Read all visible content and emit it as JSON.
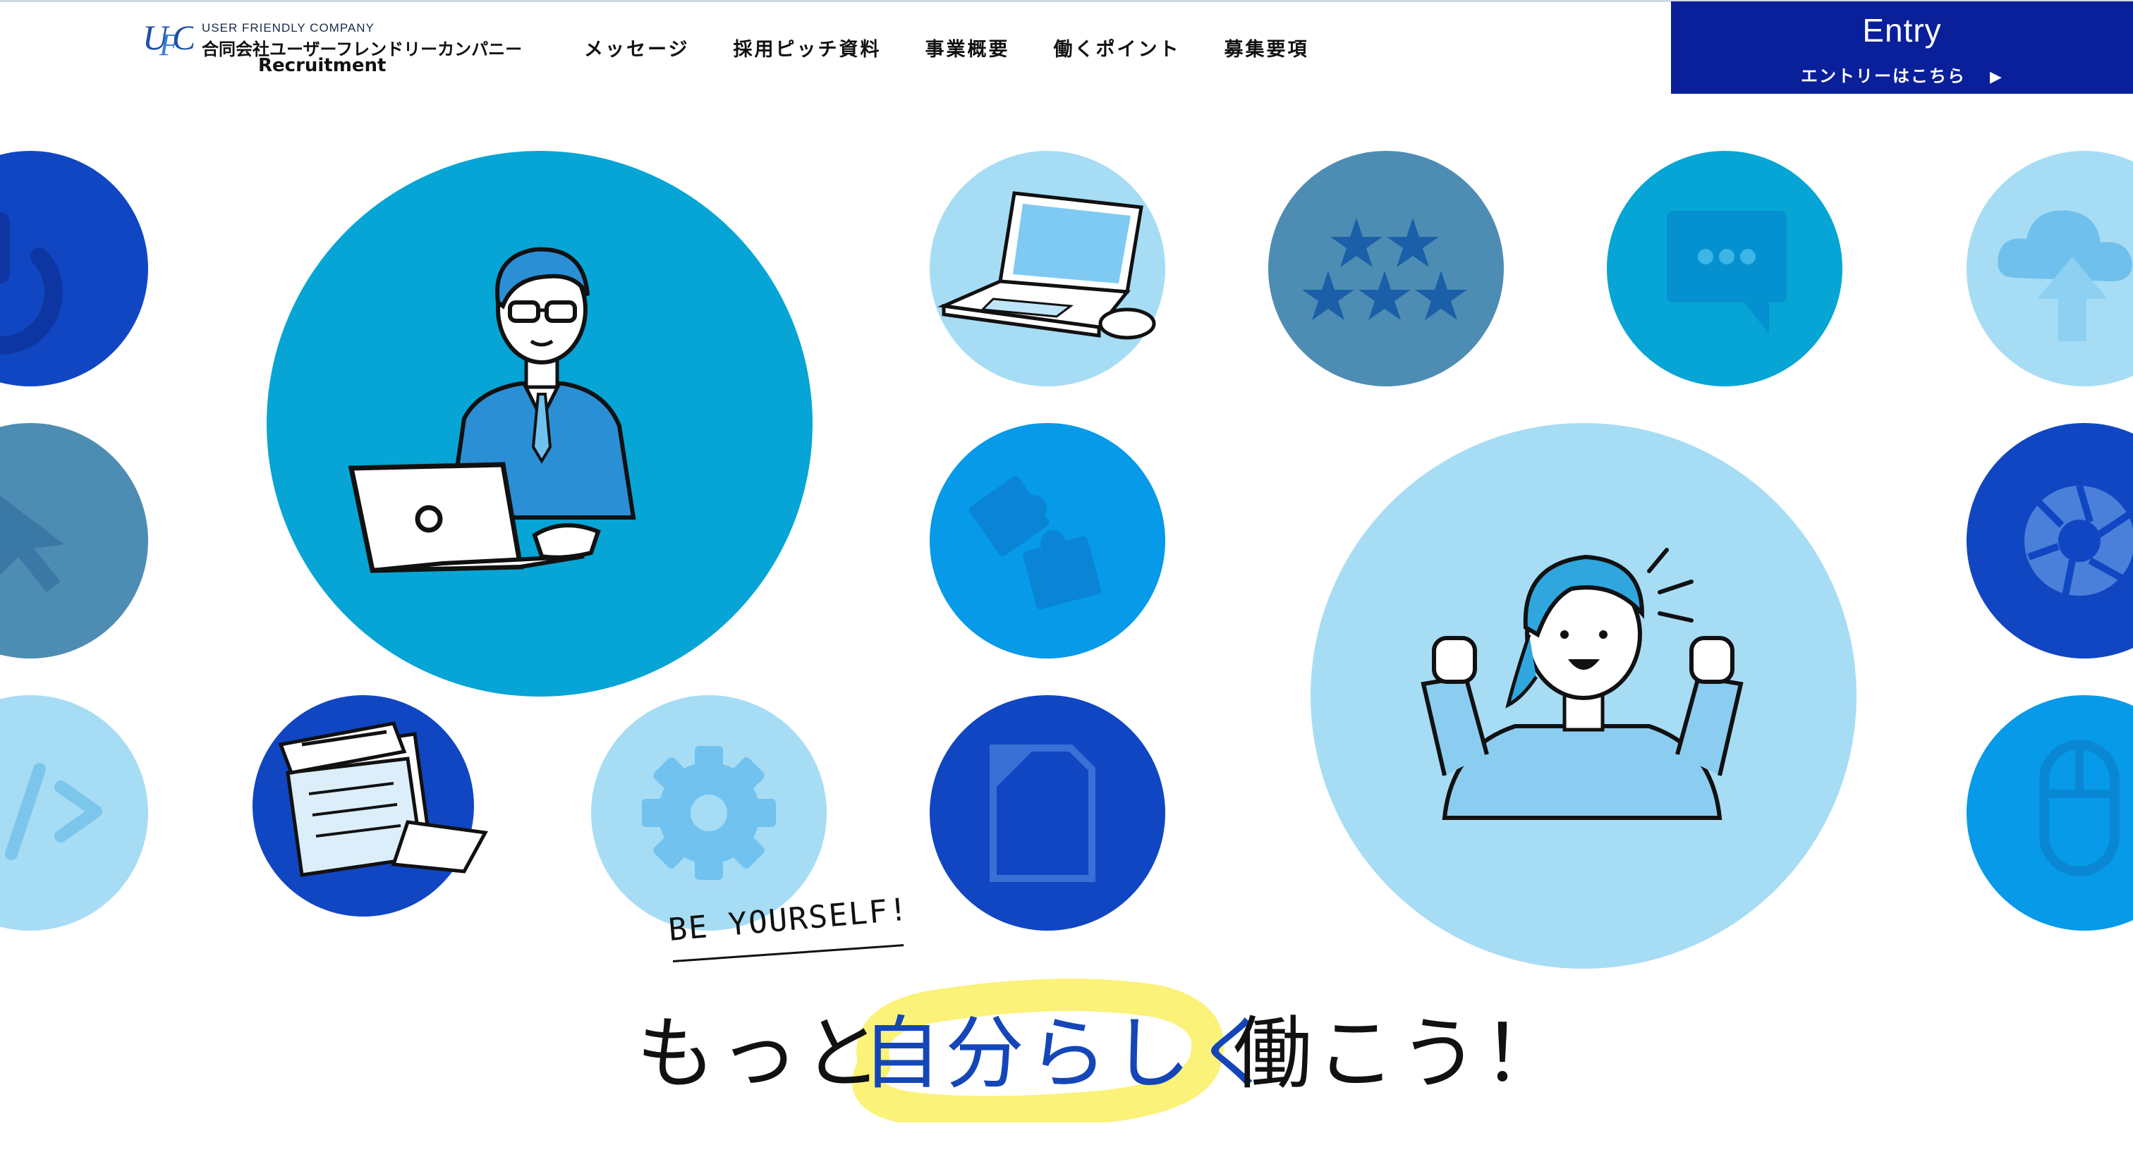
{
  "header": {
    "logo_mark": "UFC",
    "logo_en": "USER FRIENDLY COMPANY",
    "logo_jp": "合同会社ユーザーフレンドリーカンパニー",
    "logo_sub": "Recruitment",
    "nav": [
      {
        "label": "メッセージ"
      },
      {
        "label": "採用ピッチ資料"
      },
      {
        "label": "事業概要"
      },
      {
        "label": "働くポイント"
      },
      {
        "label": "募集要項"
      }
    ],
    "entry": {
      "title": "Entry",
      "subtitle": "エントリーはこちら",
      "arrow": "▶"
    }
  },
  "hero": {
    "circles": [
      {
        "name": "power-icon",
        "color": "#1146c2"
      },
      {
        "name": "cursor-icon",
        "color": "#4e8db3"
      },
      {
        "name": "code-icon",
        "color": "#a7dcf5"
      },
      {
        "name": "businessman-laptop-illustration",
        "color": "#06a5d5"
      },
      {
        "name": "document-stack-illustration",
        "color": "#1146c2"
      },
      {
        "name": "gear-icon",
        "color": "#a7dcf5"
      },
      {
        "name": "laptop-illustration",
        "color": "#a7dcf5"
      },
      {
        "name": "puzzle-icon",
        "color": "#069ae9"
      },
      {
        "name": "document-icon",
        "color": "#1146c2"
      },
      {
        "name": "stars-icon",
        "color": "#4e8db3"
      },
      {
        "name": "chat-icon",
        "color": "#06a5d5"
      },
      {
        "name": "woman-cheering-illustration",
        "color": "#a7dcf5"
      },
      {
        "name": "cloud-upload-icon",
        "color": "#a7dcf5"
      },
      {
        "name": "camera-shutter-icon",
        "color": "#1146c2"
      },
      {
        "name": "mouse-icon",
        "color": "#069ae9"
      }
    ]
  },
  "catch": {
    "tagline": "BE YOURSELF!",
    "part1": "もっと",
    "part2": "自分らしく",
    "part3": "働こう！",
    "highlight_color": "#fbf27a",
    "accent_color": "#1446b8"
  }
}
